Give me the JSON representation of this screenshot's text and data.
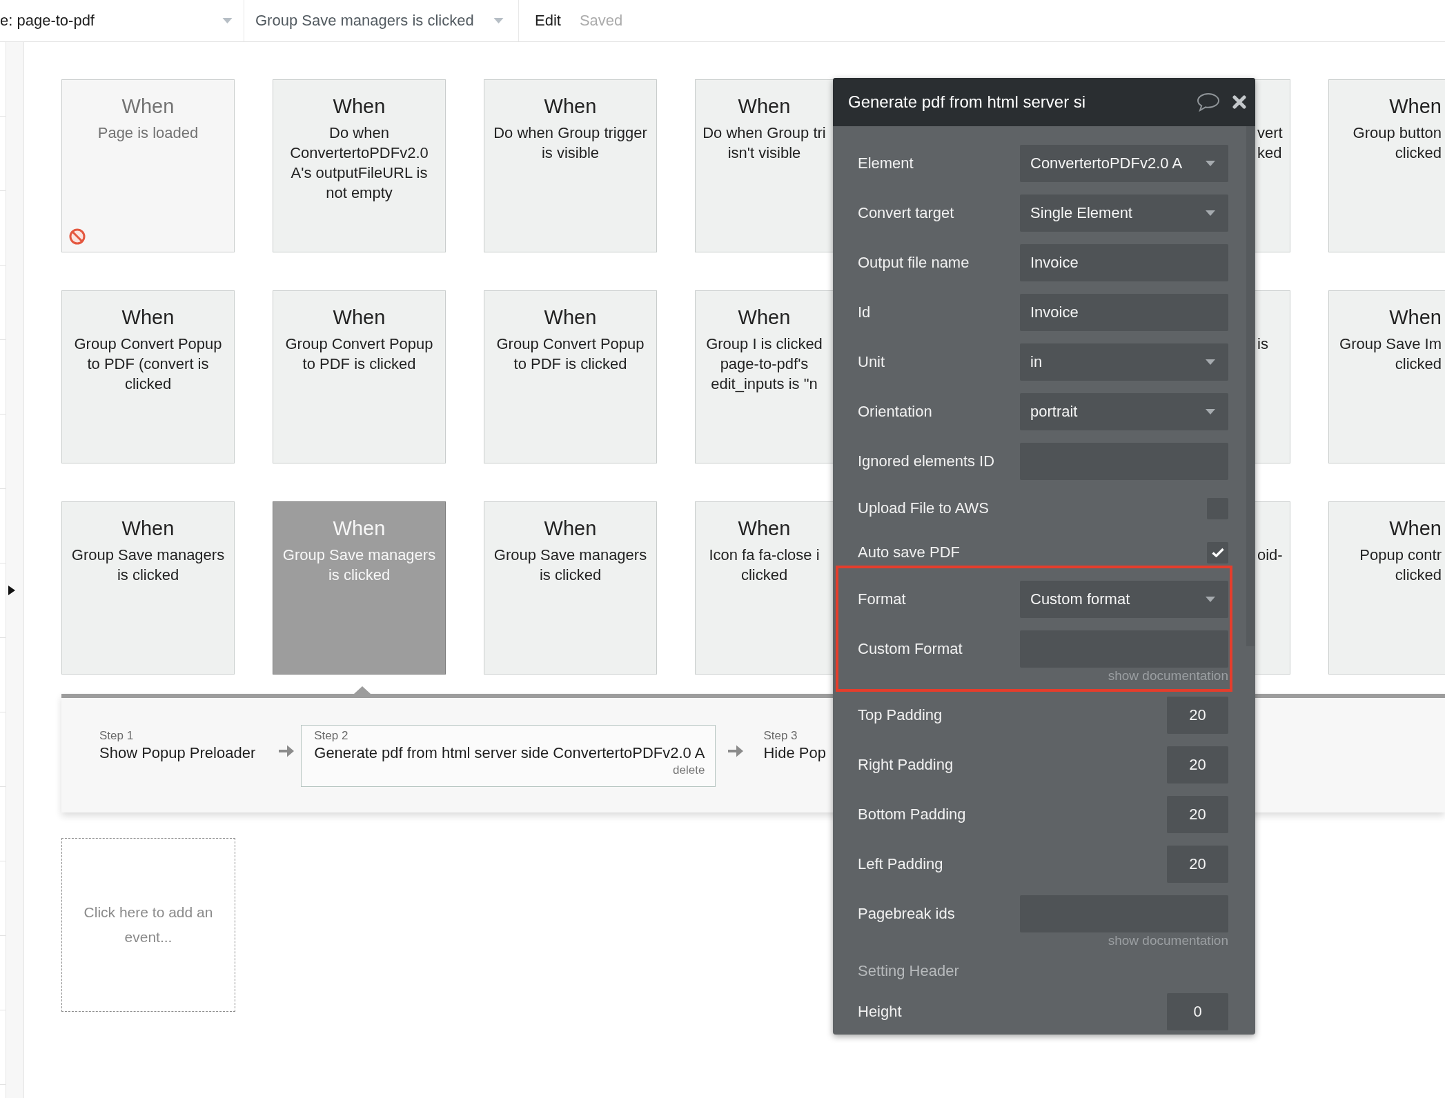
{
  "top_bar": {
    "page_selector": "e: page-to-pdf",
    "event_selector": "Group Save managers is clicked",
    "edit": "Edit",
    "status": "Saved"
  },
  "event_rows": [
    [
      {
        "kind": "full",
        "title": "When",
        "text": "Page is loaded",
        "disabled": true,
        "selected": false
      },
      {
        "kind": "full",
        "title": "When",
        "text": "Do when ConvertertoPDFv2.0 A's outputFileURL is not empty",
        "disabled": false,
        "selected": false
      },
      {
        "kind": "full",
        "title": "When",
        "text": "Do when Group trigger is visible",
        "disabled": false,
        "selected": false
      },
      {
        "kind": "cut_by_panel",
        "title": "When",
        "lines": [
          "Do when Group tri",
          "isn't visible"
        ],
        "disabled": false,
        "selected": false
      },
      {
        "kind": "behind_panel",
        "lines": [
          "vert",
          "ked"
        ],
        "disabled": false,
        "selected": false
      },
      {
        "kind": "cut_by_edge",
        "title": "When",
        "lines": [
          "Group button",
          "clicked"
        ],
        "disabled": false,
        "selected": false
      }
    ],
    [
      {
        "kind": "full",
        "title": "When",
        "text": "Group Convert Popup to PDF (convert is clicked",
        "disabled": false,
        "selected": false
      },
      {
        "kind": "full",
        "title": "When",
        "text": "Group Convert Popup to PDF is clicked",
        "disabled": false,
        "selected": false
      },
      {
        "kind": "full",
        "title": "When",
        "text": "Group Convert Popup to PDF is clicked",
        "disabled": false,
        "selected": false
      },
      {
        "kind": "cut_by_panel",
        "title": "When",
        "lines": [
          "Group I is clicked",
          "page-to-pdf's",
          "edit_inputs is \"n"
        ],
        "disabled": false,
        "selected": false
      },
      {
        "kind": "behind_panel",
        "lines": [
          "is"
        ],
        "disabled": false,
        "selected": false
      },
      {
        "kind": "cut_by_edge",
        "title": "When",
        "lines": [
          "Group Save Im",
          "clicked"
        ],
        "disabled": false,
        "selected": false
      }
    ],
    [
      {
        "kind": "full",
        "title": "When",
        "text": "Group Save managers is clicked",
        "disabled": false,
        "selected": false
      },
      {
        "kind": "full",
        "title": "When",
        "text": "Group Save managers is clicked",
        "disabled": false,
        "selected": true
      },
      {
        "kind": "full",
        "title": "When",
        "text": "Group Save managers is clicked",
        "disabled": false,
        "selected": false
      },
      {
        "kind": "cut_by_panel",
        "title": "When",
        "lines": [
          "Icon fa fa-close i",
          "clicked"
        ],
        "disabled": false,
        "selected": false
      },
      {
        "kind": "behind_panel",
        "lines": [
          "oid-"
        ],
        "disabled": false,
        "selected": false
      },
      {
        "kind": "cut_by_edge",
        "title": "When",
        "lines": [
          "Popup contr",
          "clicked"
        ],
        "disabled": false,
        "selected": false
      }
    ]
  ],
  "steps": [
    {
      "label": "Step 1",
      "action": "Show Popup Preloader",
      "selected": false
    },
    {
      "label": "Step 2",
      "action": "Generate pdf from html server side ConvertertoPDFv2.0 A",
      "selected": true,
      "delete_label": "delete"
    },
    {
      "label": "Step 3",
      "action": "Hide Pop",
      "selected": false
    }
  ],
  "add_event": "Click here to add an event...",
  "action_panel": {
    "title": "Generate pdf from html server si",
    "groups": [
      {
        "highlighted": false,
        "fields": [
          {
            "kind": "dropdown",
            "label": "Element",
            "value": "ConvertertoPDFv2.0 A"
          },
          {
            "kind": "dropdown",
            "label": "Convert target",
            "value": "Single Element"
          },
          {
            "kind": "text",
            "label": "Output file name",
            "value": "Invoice"
          },
          {
            "kind": "text",
            "label": "Id",
            "value": "Invoice"
          },
          {
            "kind": "dropdown",
            "label": "Unit",
            "value": "in"
          },
          {
            "kind": "dropdown",
            "label": "Orientation",
            "value": "portrait"
          },
          {
            "kind": "text",
            "label": "Ignored elements ID"
          },
          {
            "kind": "checkbox",
            "label": "Upload File to AWS",
            "checked": false
          },
          {
            "kind": "checkbox",
            "label": "Auto save PDF",
            "checked": true
          }
        ]
      },
      {
        "highlighted": true,
        "fields": [
          {
            "kind": "dropdown",
            "label": "Format",
            "value": "Custom format"
          },
          {
            "kind": "text",
            "label": "Custom Format",
            "doc_link": "show documentation"
          }
        ]
      },
      {
        "highlighted": false,
        "fields": [
          {
            "kind": "number",
            "label": "Top Padding",
            "value": "20"
          },
          {
            "kind": "number",
            "label": "Right Padding",
            "value": "20"
          },
          {
            "kind": "number",
            "label": "Bottom Padding",
            "value": "20"
          },
          {
            "kind": "number",
            "label": "Left Padding",
            "value": "20"
          },
          {
            "kind": "text",
            "label": "Pagebreak ids",
            "doc_link": "show documentation"
          },
          {
            "kind": "heading",
            "label": "Setting Header"
          },
          {
            "kind": "number",
            "label": "Height",
            "value": "0"
          }
        ]
      }
    ]
  }
}
